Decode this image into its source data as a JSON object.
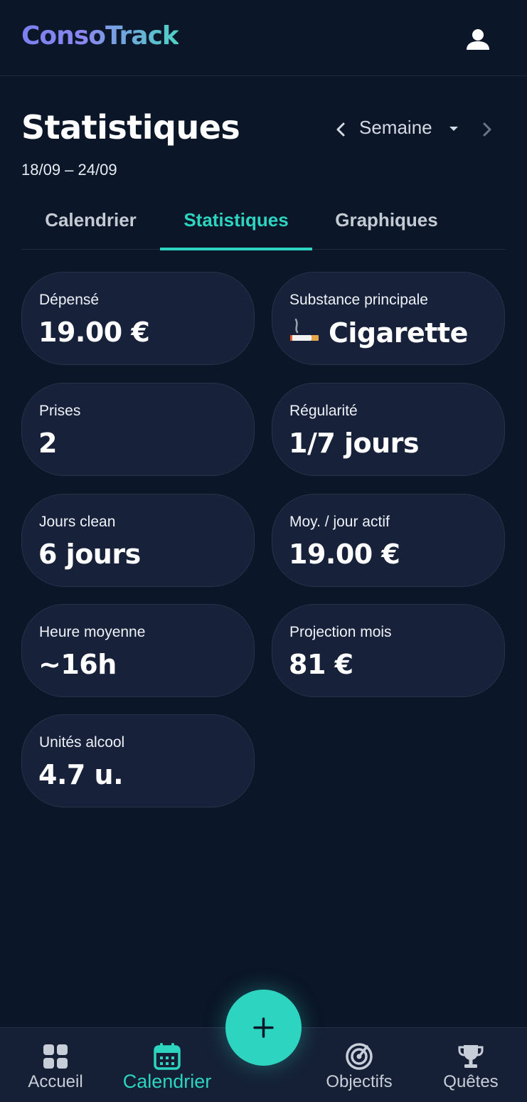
{
  "app": {
    "title": "ConsoTrack"
  },
  "header": {
    "title": "Statistiques",
    "date_range": "18/09 – 24/09",
    "period": "Semaine"
  },
  "tabs": [
    {
      "label": "Calendrier",
      "active": false
    },
    {
      "label": "Statistiques",
      "active": true
    },
    {
      "label": "Graphiques",
      "active": false
    }
  ],
  "stats": [
    {
      "label": "Dépensé",
      "value": "19.00 €"
    },
    {
      "label": "Substance principale",
      "value": "Cigarette",
      "icon": "cigarette-icon"
    },
    {
      "label": "Prises",
      "value": "2"
    },
    {
      "label": "Régularité",
      "value": "1/7 jours"
    },
    {
      "label": "Jours clean",
      "value": "6 jours"
    },
    {
      "label": "Moy. / jour actif",
      "value": "19.00 €"
    },
    {
      "label": "Heure moyenne",
      "value": "~16h"
    },
    {
      "label": "Projection mois",
      "value": "81 €"
    },
    {
      "label": "Unités alcool",
      "value": "4.7 u."
    }
  ],
  "nav": [
    {
      "label": "Accueil",
      "icon": "grid-icon",
      "active": false
    },
    {
      "label": "Calendrier",
      "icon": "calendar-icon",
      "active": true
    },
    {
      "label": "Objectifs",
      "icon": "target-icon",
      "active": false
    },
    {
      "label": "Quêtes",
      "icon": "trophy-icon",
      "active": false
    }
  ],
  "colors": {
    "background": "#0b1628",
    "card": "#17223a",
    "accent": "#2dd4bf",
    "logo_start": "#7b7ff0"
  }
}
